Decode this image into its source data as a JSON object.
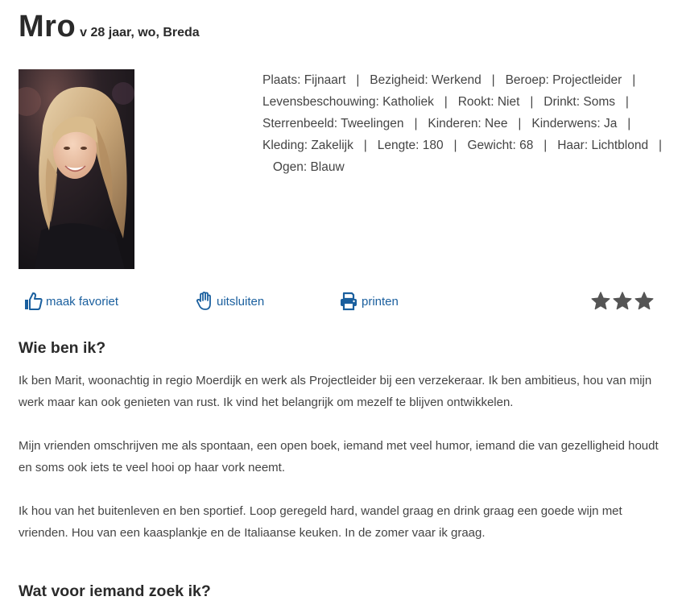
{
  "profile": {
    "name": "Mro",
    "subtitle": "v 28 jaar, wo, Breda",
    "photo_alt": "profielfoto"
  },
  "attributes": [
    "Plaats: Fijnaart",
    "Bezigheid: Werkend",
    "Beroep: Projectleider",
    "Levensbeschouwing: Katholiek",
    "Rookt: Niet",
    "Drinkt: Soms",
    "Sterrenbeeld: Tweelingen",
    "Kinderen: Nee",
    "Kinderwens: Ja",
    "Kleding: Zakelijk",
    "Lengte: 180",
    "Gewicht: 68",
    "Haar: Lichtblond",
    "Ogen: Blauw"
  ],
  "attribute_separator": "|",
  "actions": {
    "favorite_label": "maak favoriet",
    "exclude_label": "uitsluiten",
    "print_label": "printen"
  },
  "rating": {
    "stars": 3
  },
  "about": {
    "title": "Wie ben ik?",
    "paragraphs": [
      "Ik ben Marit, woonachtig in regio Moerdijk en werk als Projectleider bij een verzekeraar. Ik ben ambitieus, hou van mijn werk maar kan ook genieten van rust. Ik vind het belangrijk om mezelf te blijven ontwikkelen.",
      "Mijn vrienden omschrijven me als spontaan, een open boek, iemand met veel humor, iemand die van gezelligheid houdt en soms ook iets te veel hooi op haar vork neemt.",
      "Ik hou van het buitenleven en ben sportief. Loop geregeld hard, wandel graag en drink graag een goede wijn met vrienden. Hou van een kaasplankje en de Italiaanse keuken. In de zomer vaar ik graag."
    ]
  },
  "seeking": {
    "title": "Wat voor iemand zoek ik?"
  },
  "colors": {
    "link": "#1a5f9e",
    "star": "#555555",
    "heading": "#2a2a2a",
    "text": "#444444"
  },
  "icons": {
    "favorite": "thumbs-up-icon",
    "exclude": "hand-stop-icon",
    "print": "printer-icon",
    "star": "star-icon"
  }
}
